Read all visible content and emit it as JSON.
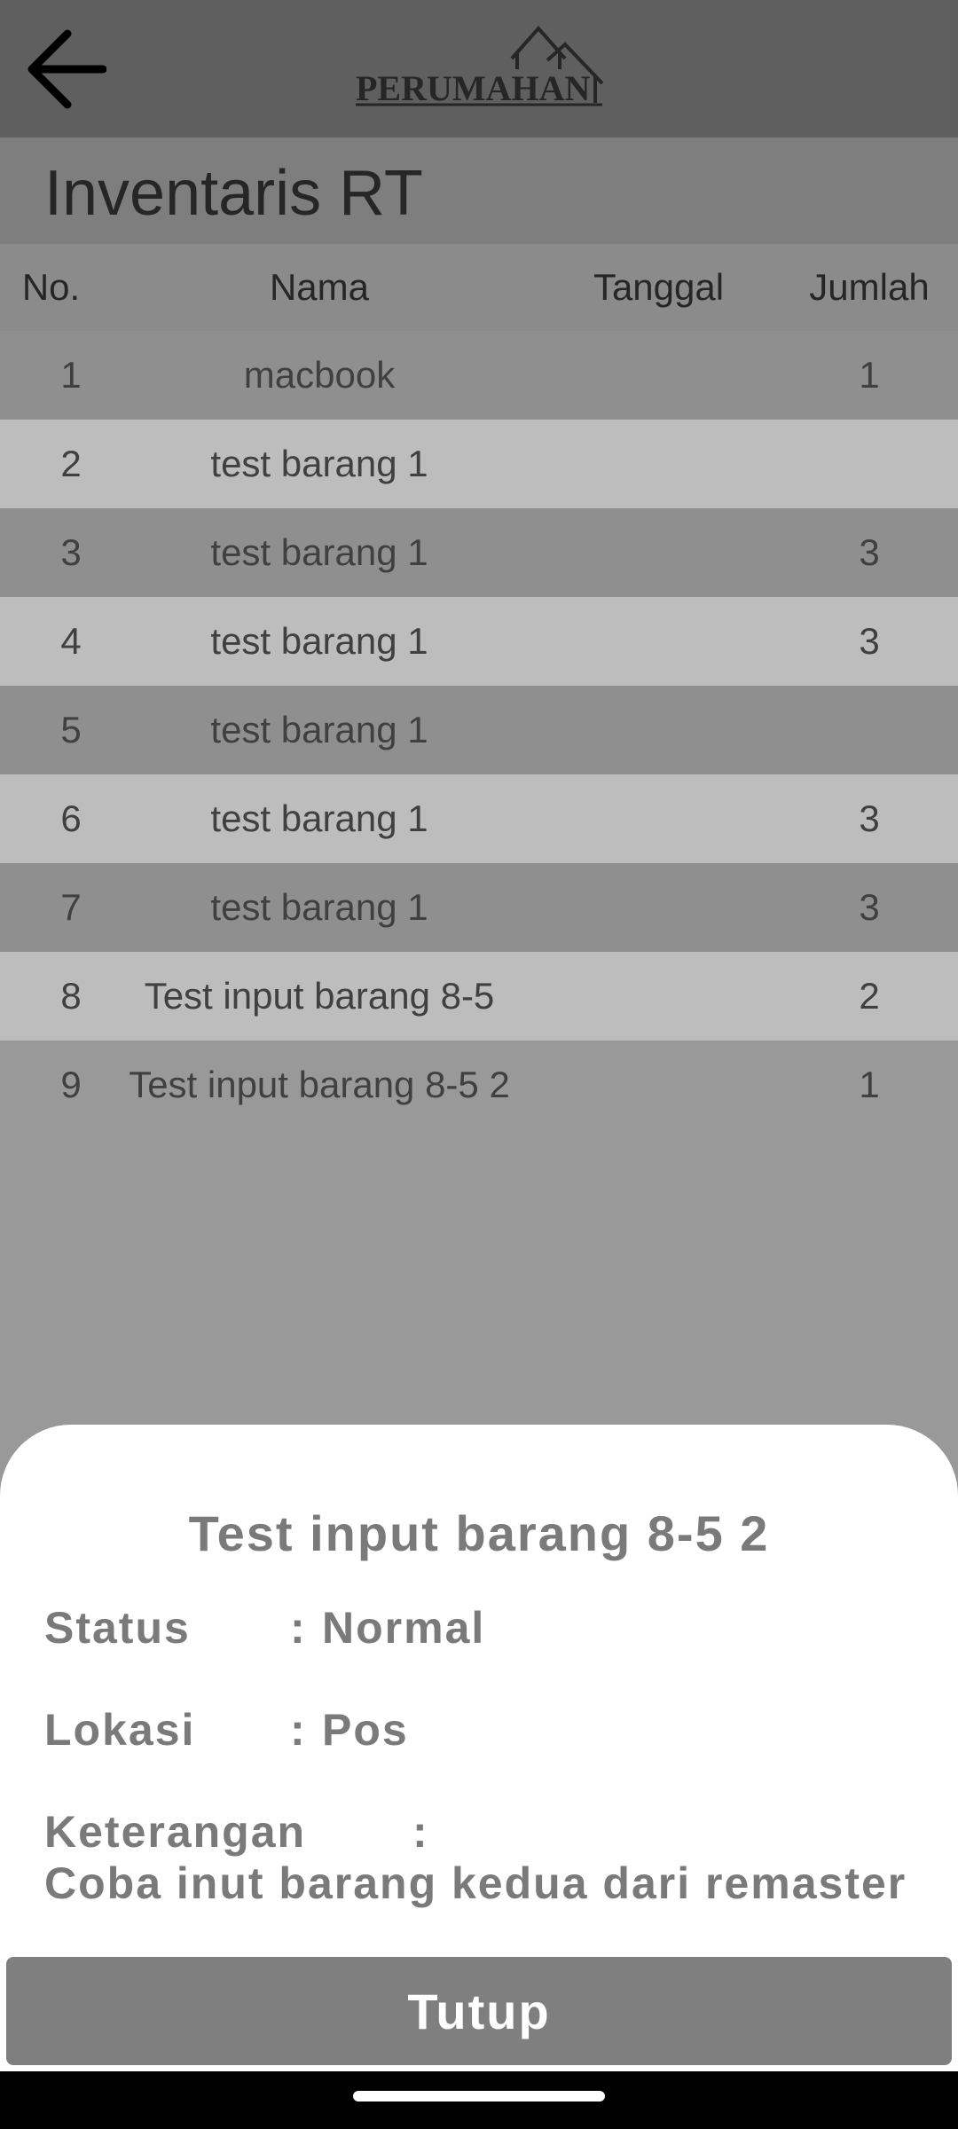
{
  "header": {
    "logo_text": "PERUMAHAN",
    "back_icon": "arrow-left-icon"
  },
  "page": {
    "title": "Inventaris RT"
  },
  "table": {
    "columns": [
      "No.",
      "Nama",
      "Tanggal",
      "Jumlah"
    ],
    "rows": [
      {
        "no": "1",
        "nama": "macbook",
        "tanggal": "",
        "jumlah": "1"
      },
      {
        "no": "2",
        "nama": "test barang 1",
        "tanggal": "",
        "jumlah": ""
      },
      {
        "no": "3",
        "nama": "test barang 1",
        "tanggal": "",
        "jumlah": "3"
      },
      {
        "no": "4",
        "nama": "test barang 1",
        "tanggal": "",
        "jumlah": "3"
      },
      {
        "no": "5",
        "nama": "test barang 1",
        "tanggal": "",
        "jumlah": ""
      },
      {
        "no": "6",
        "nama": "test barang 1",
        "tanggal": "",
        "jumlah": "3"
      },
      {
        "no": "7",
        "nama": "test barang 1",
        "tanggal": "",
        "jumlah": "3"
      },
      {
        "no": "8",
        "nama": "Test input barang 8-5",
        "tanggal": "",
        "jumlah": "2"
      },
      {
        "no": "9",
        "nama": "Test input barang 8-5 2",
        "tanggal": "",
        "jumlah": "1"
      }
    ]
  },
  "detail_sheet": {
    "title": "Test input barang 8-5 2",
    "status_label": "Status",
    "status_value": "Normal",
    "lokasi_label": "Lokasi",
    "lokasi_value": "Pos",
    "keterangan_label": "Keterangan",
    "keterangan_value": "Coba inut barang kedua dari remaster",
    "colon": ":",
    "close_label": "Tutup"
  },
  "colors": {
    "appbar": "#5f5f5f",
    "scrim": "#999999",
    "sheet": "#ffffff",
    "button": "#7f7f7f"
  }
}
